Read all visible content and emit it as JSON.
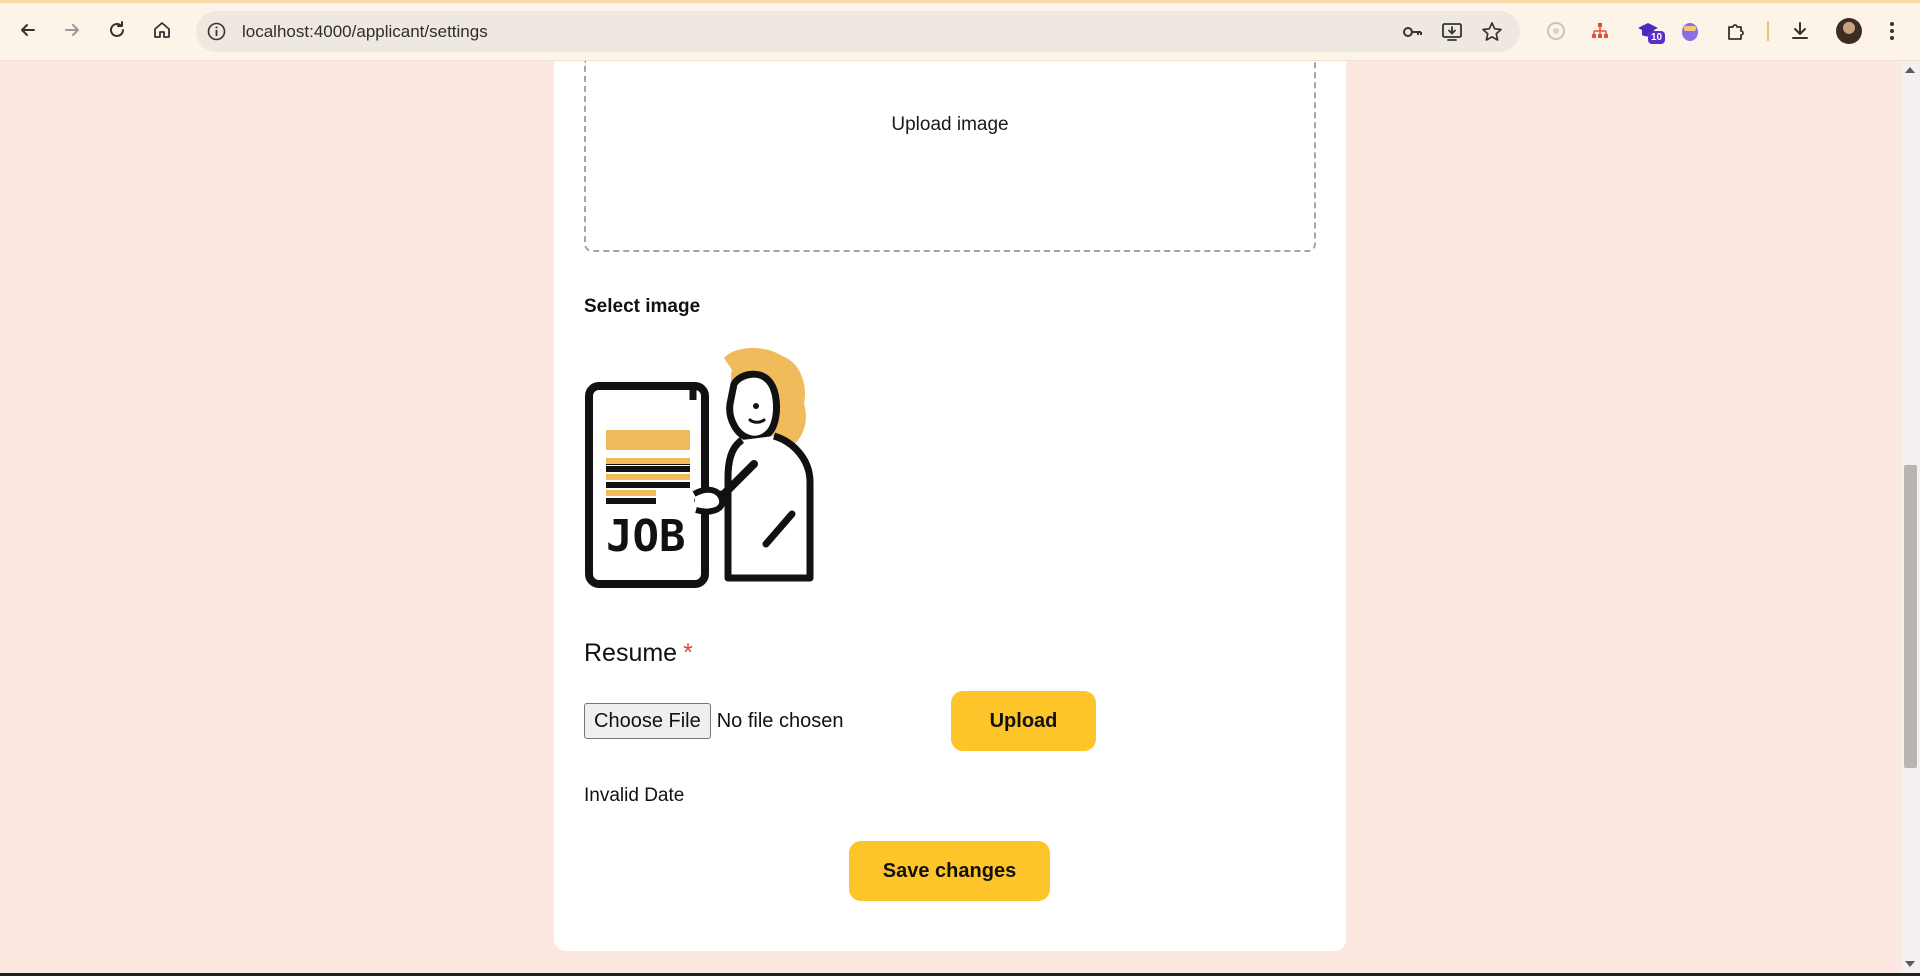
{
  "browser": {
    "url": "localhost:4000/applicant/settings",
    "extension_badge": "10",
    "icons": {
      "back": "back-arrow-icon",
      "forward": "forward-arrow-icon",
      "reload": "reload-icon",
      "home": "home-icon",
      "site_info": "info-icon",
      "passwords": "key-icon",
      "install": "install-app-icon",
      "bookmark": "star-icon",
      "extensions": "puzzle-icon",
      "downloads": "download-icon",
      "menu": "kebab-menu-icon"
    }
  },
  "page": {
    "dropzone_text": "Upload image",
    "select_image_label": "Select image",
    "image_text": "JOB",
    "resume_label": "Resume",
    "required_mark": "*",
    "choose_file_label": "Choose File",
    "file_status": "No file chosen",
    "upload_button": "Upload",
    "date_text": "Invalid Date",
    "save_button": "Save changes"
  },
  "colors": {
    "page_bg": "#fde8e1",
    "card_bg": "#ffffff",
    "accent_button": "#fdc52a",
    "required": "#e0453a",
    "illustration_accent": "#f0bb5b"
  }
}
